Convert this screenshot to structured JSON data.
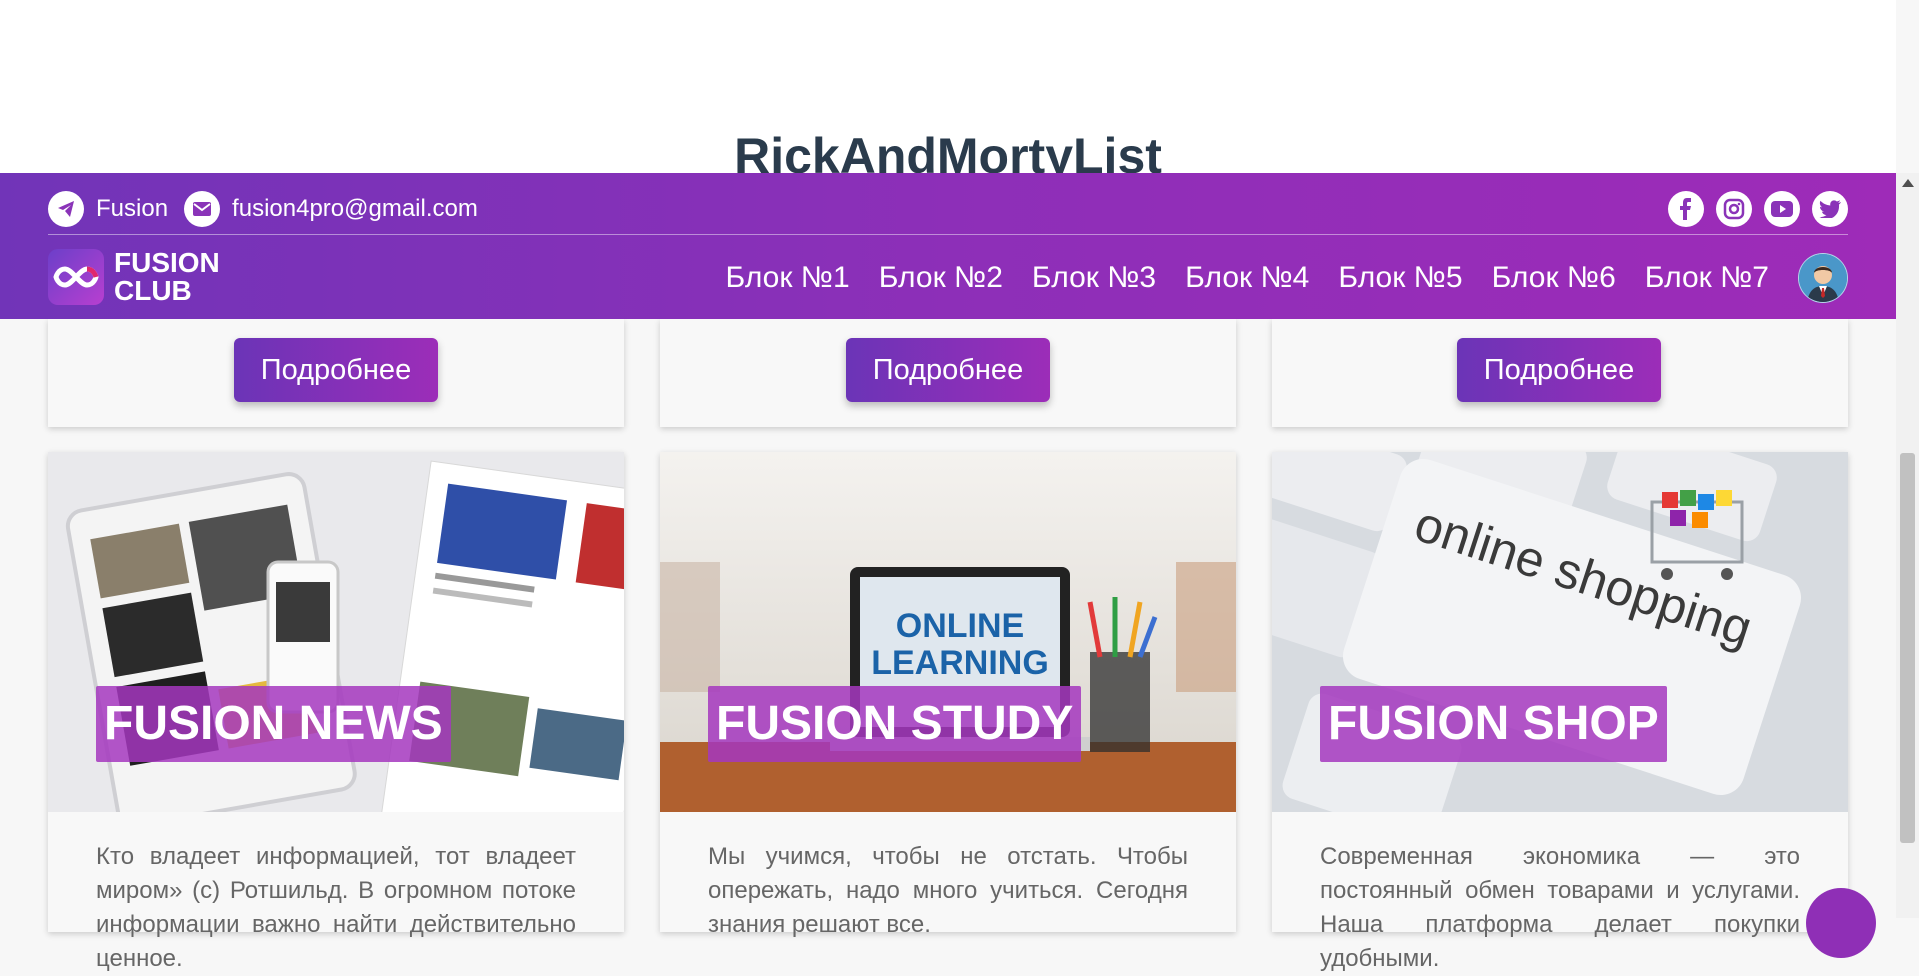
{
  "page": {
    "title": "RickAndMortyList"
  },
  "header": {
    "contacts": {
      "telegram_label": "Fusion",
      "email": "fusion4pro@gmail.com"
    },
    "social_icons": [
      "facebook-icon",
      "instagram-icon",
      "youtube-icon",
      "twitter-icon"
    ],
    "logo": {
      "line1": "FUSION",
      "line2": "CLUB"
    },
    "nav": [
      "Блок №1",
      "Блок №2",
      "Блок №3",
      "Блок №4",
      "Блок №5",
      "Блок №6",
      "Блок №7"
    ]
  },
  "top_cards": {
    "button_label": "Подробнее"
  },
  "cards": [
    {
      "label": "FUSION NEWS",
      "text": "Кто владеет информацией, тот владеет миром» (с) Ротшильд. В огромном потоке информации важно найти действительно ценное."
    },
    {
      "label": "FUSION STUDY",
      "text": "Мы учимся, чтобы не отстать. Чтобы опережать, надо много учиться. Сегодня знания решают все."
    },
    {
      "label": "FUSION SHOP",
      "text": "Современная экономика — это постоянный обмен товарами и услугами. Наша платформа делает покупки удобными."
    }
  ],
  "card_image_texts": {
    "study_screen_line1": "ONLINE",
    "study_screen_line2": "LEARNING",
    "shop_key": "online shopping"
  },
  "colors": {
    "header_start": "#7134b8",
    "header_end": "#9e2bb8",
    "label_bg": "#a537be",
    "title": "#2a3b4c"
  }
}
